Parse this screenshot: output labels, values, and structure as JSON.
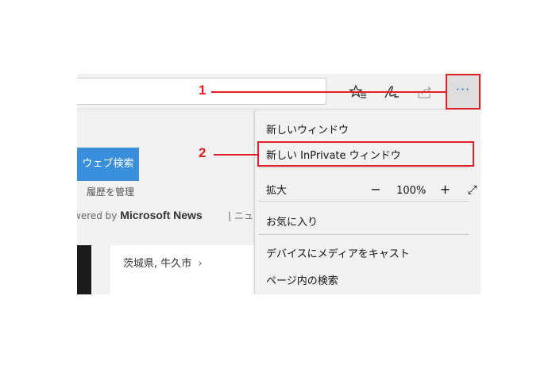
{
  "toolbar": {
    "favorites_icon": "star-list-icon",
    "notes_icon": "pen-icon",
    "share_icon": "share-icon",
    "more_label": "···"
  },
  "page": {
    "search_button": "ウェブ検索",
    "history_link": "履歴を管理",
    "powered_prefix": "wered by",
    "powered_brand": "Microsoft News",
    "separator": "|",
    "news_tab": "ニュー",
    "weather_location": "茨城県, 牛久市",
    "chevron": "›"
  },
  "menu": {
    "new_window": "新しいウィンドウ",
    "new_inprivate": "新しい InPrivate ウィンドウ",
    "zoom_label": "拡大",
    "zoom_minus": "−",
    "zoom_level": "100%",
    "zoom_plus": "+",
    "zoom_fullscreen": "⤢",
    "favorites": "お気に入り",
    "cast": "デバイスにメディアをキャスト",
    "find_on_page": "ページ内の検索"
  },
  "annotations": {
    "step1": "1",
    "step2": "2",
    "color": "#e21f26"
  }
}
